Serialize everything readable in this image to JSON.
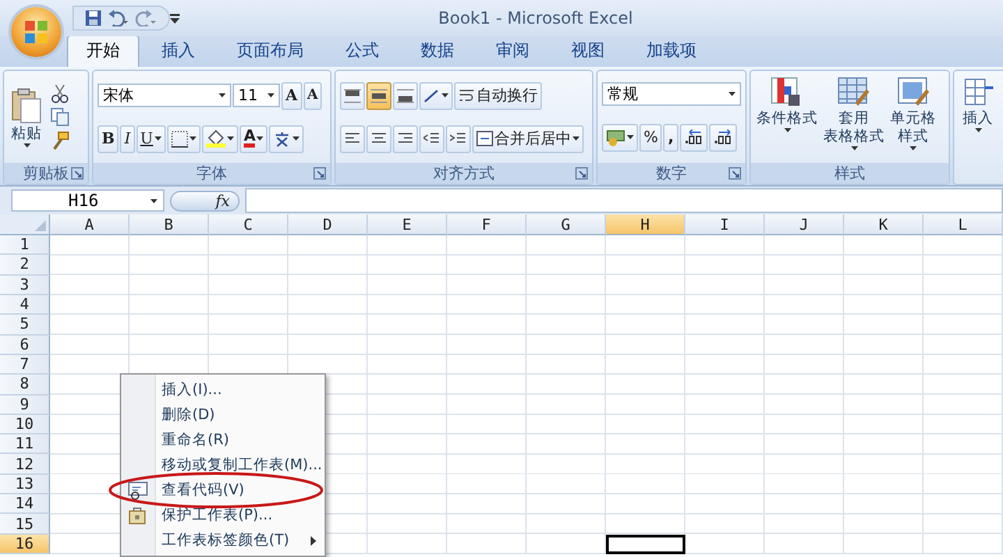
{
  "window": {
    "title": "Book1 - Microsoft Excel"
  },
  "tabs": [
    {
      "label": "开始",
      "selected": true
    },
    {
      "label": "插入",
      "selected": false
    },
    {
      "label": "页面布局",
      "selected": false
    },
    {
      "label": "公式",
      "selected": false
    },
    {
      "label": "数据",
      "selected": false
    },
    {
      "label": "审阅",
      "selected": false
    },
    {
      "label": "视图",
      "selected": false
    },
    {
      "label": "加载项",
      "selected": false
    }
  ],
  "ribbon": {
    "groups": [
      {
        "kind": "clipboard",
        "label": "剪贴板",
        "dialog_launcher": true,
        "paste": "粘贴"
      },
      {
        "kind": "font",
        "label": "字体",
        "dialog_launcher": true,
        "font_name": "宋体",
        "font_size": "11",
        "grow": "A",
        "shrink": "A",
        "bold": "B",
        "italic": "I",
        "underline": "U",
        "font_color": "A"
      },
      {
        "kind": "alignment",
        "label": "对齐方式",
        "dialog_launcher": true,
        "vertical_align": [
          {
            "selected": false
          },
          {
            "selected": true
          },
          {
            "selected": false
          }
        ],
        "wrap_text": "自动换行",
        "merge": "合并后居中"
      },
      {
        "kind": "number",
        "label": "数字",
        "dialog_launcher": true,
        "format": "常规",
        "percent": "%",
        "comma": ","
      },
      {
        "kind": "styles",
        "label": "样式",
        "dialog_launcher": false,
        "buttons": [
          {
            "kind": "conditional",
            "lines": [
              "条件格式"
            ]
          },
          {
            "kind": "table",
            "lines": [
              "套用",
              "表格格式"
            ]
          },
          {
            "kind": "cell",
            "lines": [
              "单元格",
              "样式"
            ]
          }
        ]
      },
      {
        "kind": "cells",
        "buttons": [
          {
            "kind": "insert",
            "lines": [
              "插入"
            ]
          }
        ]
      }
    ]
  },
  "formula_bar": {
    "name_box": "H16",
    "function_label": "fx"
  },
  "sheet": {
    "columns": [
      {
        "label": "A",
        "selected": false
      },
      {
        "label": "B",
        "selected": false
      },
      {
        "label": "C",
        "selected": false
      },
      {
        "label": "D",
        "selected": false
      },
      {
        "label": "E",
        "selected": false
      },
      {
        "label": "F",
        "selected": false
      },
      {
        "label": "G",
        "selected": false
      },
      {
        "label": "H",
        "selected": true
      },
      {
        "label": "I",
        "selected": false
      },
      {
        "label": "J",
        "selected": false
      },
      {
        "label": "K",
        "selected": false
      },
      {
        "label": "L",
        "selected": false
      }
    ],
    "rows": [
      {
        "label": "1",
        "selected": false
      },
      {
        "label": "2",
        "selected": false
      },
      {
        "label": "3",
        "selected": false
      },
      {
        "label": "4",
        "selected": false
      },
      {
        "label": "5",
        "selected": false
      },
      {
        "label": "6",
        "selected": false
      },
      {
        "label": "7",
        "selected": false
      },
      {
        "label": "8",
        "selected": false
      },
      {
        "label": "9",
        "selected": false
      },
      {
        "label": "10",
        "selected": false
      },
      {
        "label": "11",
        "selected": false
      },
      {
        "label": "12",
        "selected": false
      },
      {
        "label": "13",
        "selected": false
      },
      {
        "label": "14",
        "selected": false
      },
      {
        "label": "15",
        "selected": false
      },
      {
        "label": "16",
        "selected": true
      }
    ]
  },
  "context_menu": {
    "items": [
      {
        "kind": "plain",
        "label": "插入(I)...",
        "circled": false
      },
      {
        "kind": "plain",
        "label": "删除(D)",
        "circled": false
      },
      {
        "kind": "plain",
        "label": "重命名(R)",
        "circled": false
      },
      {
        "kind": "plain",
        "label": "移动或复制工作表(M)...",
        "circled": false
      },
      {
        "kind": "code",
        "label": "查看代码(V)",
        "circled": true
      },
      {
        "kind": "protect",
        "label": "保护工作表(P)...",
        "circled": false
      },
      {
        "kind": "submenu",
        "label": "工作表标签颜色(T)",
        "circled": false
      }
    ]
  }
}
